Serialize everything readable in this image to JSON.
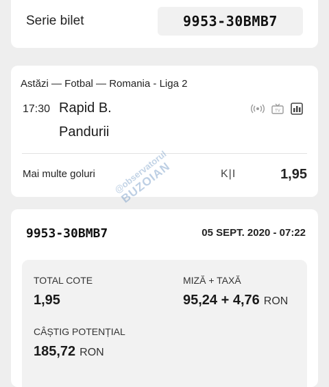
{
  "serie": {
    "label": "Serie bilet",
    "code": "9953-30BMB7"
  },
  "event": {
    "header": "Astăzi — Fotbal — Romania - Liga 2",
    "time": "17:30",
    "team_home": "Rapid B.",
    "team_away": "Pandurii",
    "icons": [
      "live-stream-icon",
      "tv-icon",
      "statistics-icon"
    ],
    "market": "Mai multe goluri",
    "live_indicator": "K|I",
    "odds": "1,95"
  },
  "ticket": {
    "code": "9953-30BMB7",
    "date": "05 SEPT. 2020 - 07:22",
    "total_odds_label": "TOTAL COTE",
    "total_odds_value": "1,95",
    "stake_label": "MIZĂ + TAXĂ",
    "stake_value": "95,24 + 4,76",
    "stake_currency": "RON",
    "potential_label": "CÂȘTIG POTENȚIAL",
    "potential_value": "185,72",
    "potential_currency": "RON"
  },
  "watermark": {
    "line1": "@observatorul",
    "line2": "BUZOIAN"
  }
}
